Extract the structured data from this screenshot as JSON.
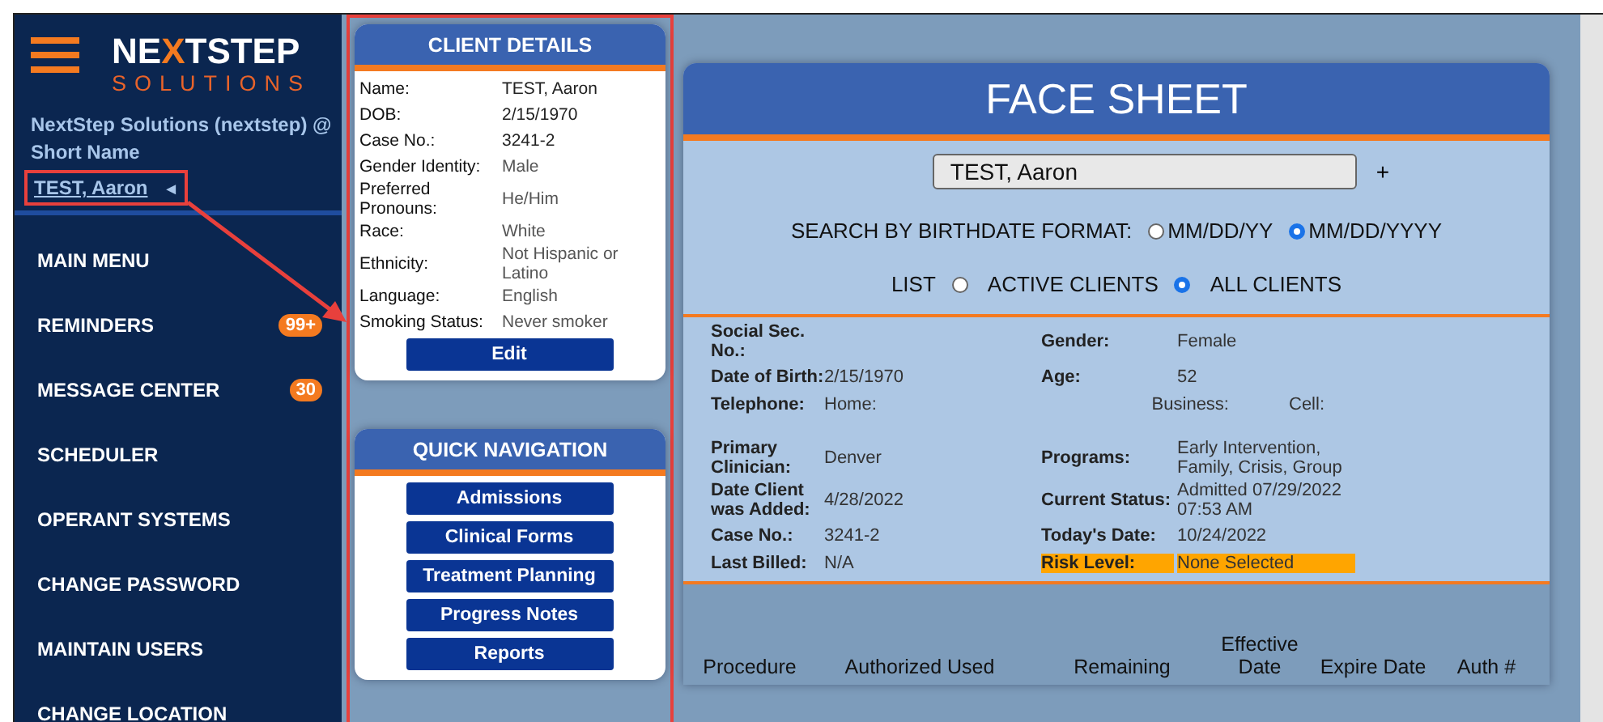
{
  "sidebar": {
    "logo": {
      "parts": [
        "NE",
        "X",
        "TSTEP"
      ],
      "sub": "SOLUTIONS"
    },
    "org": "NextStep Solutions (nextstep) @ Short Name",
    "client_link": {
      "text": "TEST, Aaron",
      "icon": "◄",
      "highlighted": true
    },
    "items": [
      {
        "label": "MAIN MENU"
      },
      {
        "label": "REMINDERS",
        "badge": "99+"
      },
      {
        "label": "MESSAGE CENTER",
        "badge": "30"
      },
      {
        "label": "SCHEDULER"
      },
      {
        "label": "OPERANT SYSTEMS"
      },
      {
        "label": "CHANGE PASSWORD"
      },
      {
        "label": "MAINTAIN USERS"
      },
      {
        "label": "CHANGE LOCATION"
      }
    ]
  },
  "side_panels": {
    "highlighted": true,
    "client_details": {
      "title": "CLIENT DETAILS",
      "rows": [
        {
          "label": "Name:",
          "value": "TEST, Aaron",
          "emphasis": true
        },
        {
          "label": "DOB:",
          "value": "2/15/1970",
          "emphasis": true
        },
        {
          "label": "Case No.:",
          "value": "3241-2",
          "emphasis": true
        },
        {
          "label": "Gender Identity:",
          "value": "Male",
          "emphasis": false
        },
        {
          "label": "Preferred Pronouns:",
          "value": "He/Him",
          "emphasis": false
        },
        {
          "label": "Race:",
          "value": "White",
          "emphasis": false
        },
        {
          "label": "Ethnicity:",
          "value": "Not Hispanic or Latino",
          "emphasis": false
        },
        {
          "label": "Language:",
          "value": "English",
          "emphasis": false
        },
        {
          "label": "Smoking Status:",
          "value": "Never smoker",
          "emphasis": false
        }
      ],
      "button": "Edit"
    },
    "quick_navigation": {
      "title": "QUICK NAVIGATION",
      "buttons": [
        "Admissions",
        "Clinical Forms",
        "Treatment Planning",
        "Progress Notes",
        "Reports"
      ]
    }
  },
  "annotations": [
    {
      "kind": "arrow"
    }
  ],
  "face_sheet": {
    "title": "FACE SHEET",
    "search": {
      "value": "TEST, Aaron",
      "add": "+"
    },
    "birthdate_format": {
      "label": "SEARCH BY BIRTHDATE FORMAT:",
      "options": [
        {
          "label": "MM/DD/YY",
          "selected": false
        },
        {
          "label": "MM/DD/YYYY",
          "selected": true
        }
      ]
    },
    "list_filter": {
      "label": "LIST",
      "options": [
        {
          "label": "ACTIVE CLIENTS",
          "selected": false
        },
        {
          "label": "ALL CLIENTS",
          "selected": true
        }
      ]
    },
    "info": [
      {
        "kind": "pair",
        "label": "Social Sec. No.:",
        "label2": "Gender:",
        "value2": "Female"
      },
      {
        "kind": "pair",
        "label": "Date of Birth:",
        "value": "2/15/1970",
        "label2": "Age:",
        "value2": "52"
      },
      {
        "kind": "phone",
        "label": "Telephone:",
        "home": "Home:",
        "business": "Business:",
        "cell": "Cell:"
      },
      {
        "kind": "pair",
        "label": "Primary Clinician:",
        "value": "Denver",
        "label2": "Programs:",
        "value2": "Early Intervention, Family, Crisis, Group"
      },
      {
        "kind": "pair",
        "label": "Date Client was Added:",
        "value": "4/28/2022",
        "label2": "Current Status:",
        "value2": "Admitted 07/29/2022 07:53 AM"
      },
      {
        "kind": "pair",
        "label": "Case No.:",
        "value": "3241-2",
        "label2": "Today's Date:",
        "value2": "10/24/2022"
      },
      {
        "kind": "pair",
        "label": "Last Billed:",
        "value": "N/A",
        "label2": "Risk Level:",
        "value2": "None Selected",
        "highlight": true
      }
    ],
    "table_columns": [
      "Procedure",
      "Authorized Used",
      "Remaining",
      "Effective Date",
      "Expire Date",
      "Auth #"
    ]
  }
}
